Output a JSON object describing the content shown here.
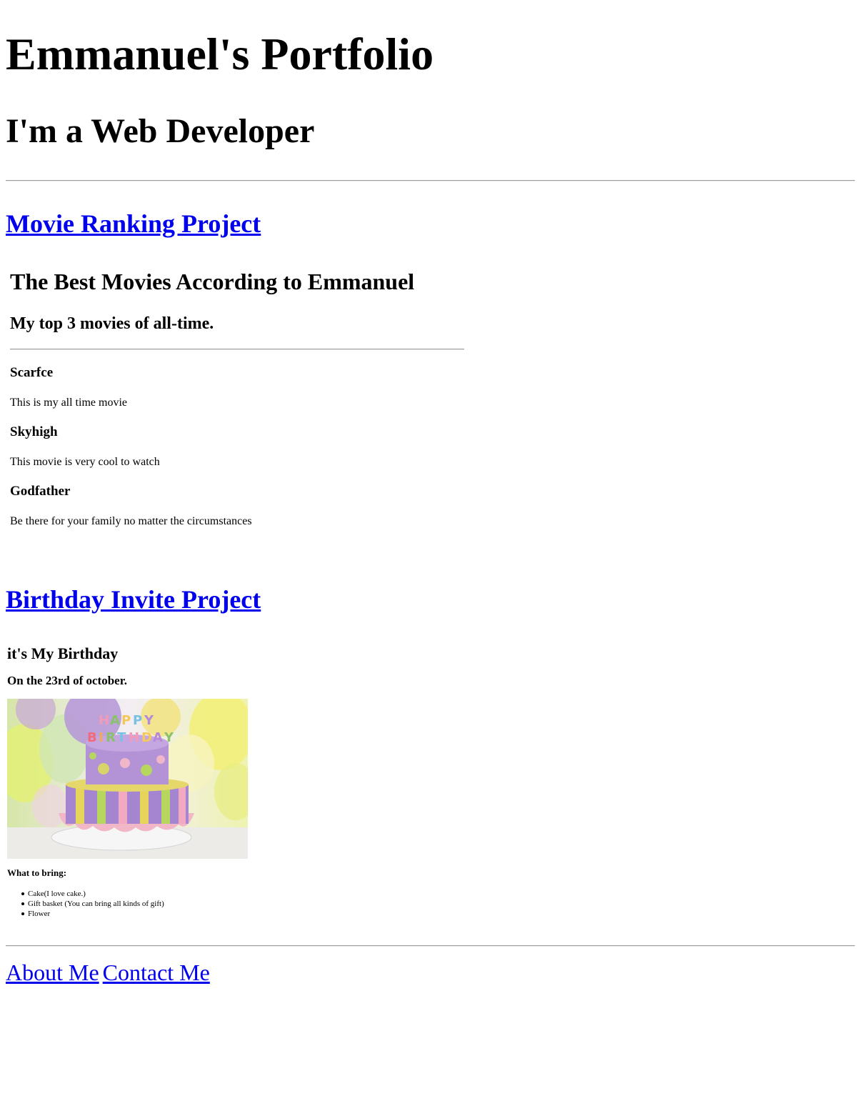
{
  "header": {
    "title": "Emmanuel's Portfolio",
    "subtitle": "I'm a Web Developer"
  },
  "movie_project": {
    "link_label": "Movie Ranking Project",
    "title": "The Best Movies According to Emmanuel",
    "subtitle": "My top 3 movies of all-time.",
    "movies": [
      {
        "name": "Scarfce",
        "description": "This is my all time movie"
      },
      {
        "name": "Skyhigh",
        "description": "This movie is very cool to watch"
      },
      {
        "name": "Godfather",
        "description": "Be there for your family no matter the circumstances"
      }
    ]
  },
  "birthday_project": {
    "link_label": "Birthday Invite Project",
    "title": "it's My Birthday",
    "subtitle": "On the 23rd of october.",
    "image_text": "HAPPY BIRTHDAY",
    "bring_label": "What to bring:",
    "items": [
      "Cake(I love cake.)",
      "Gift basket (You can bring all kinds of gift)",
      "Flower"
    ]
  },
  "footer": {
    "about_label": "About Me",
    "contact_label": "Contact Me"
  },
  "colors": {
    "link": "#0000ee",
    "text": "#000000"
  }
}
